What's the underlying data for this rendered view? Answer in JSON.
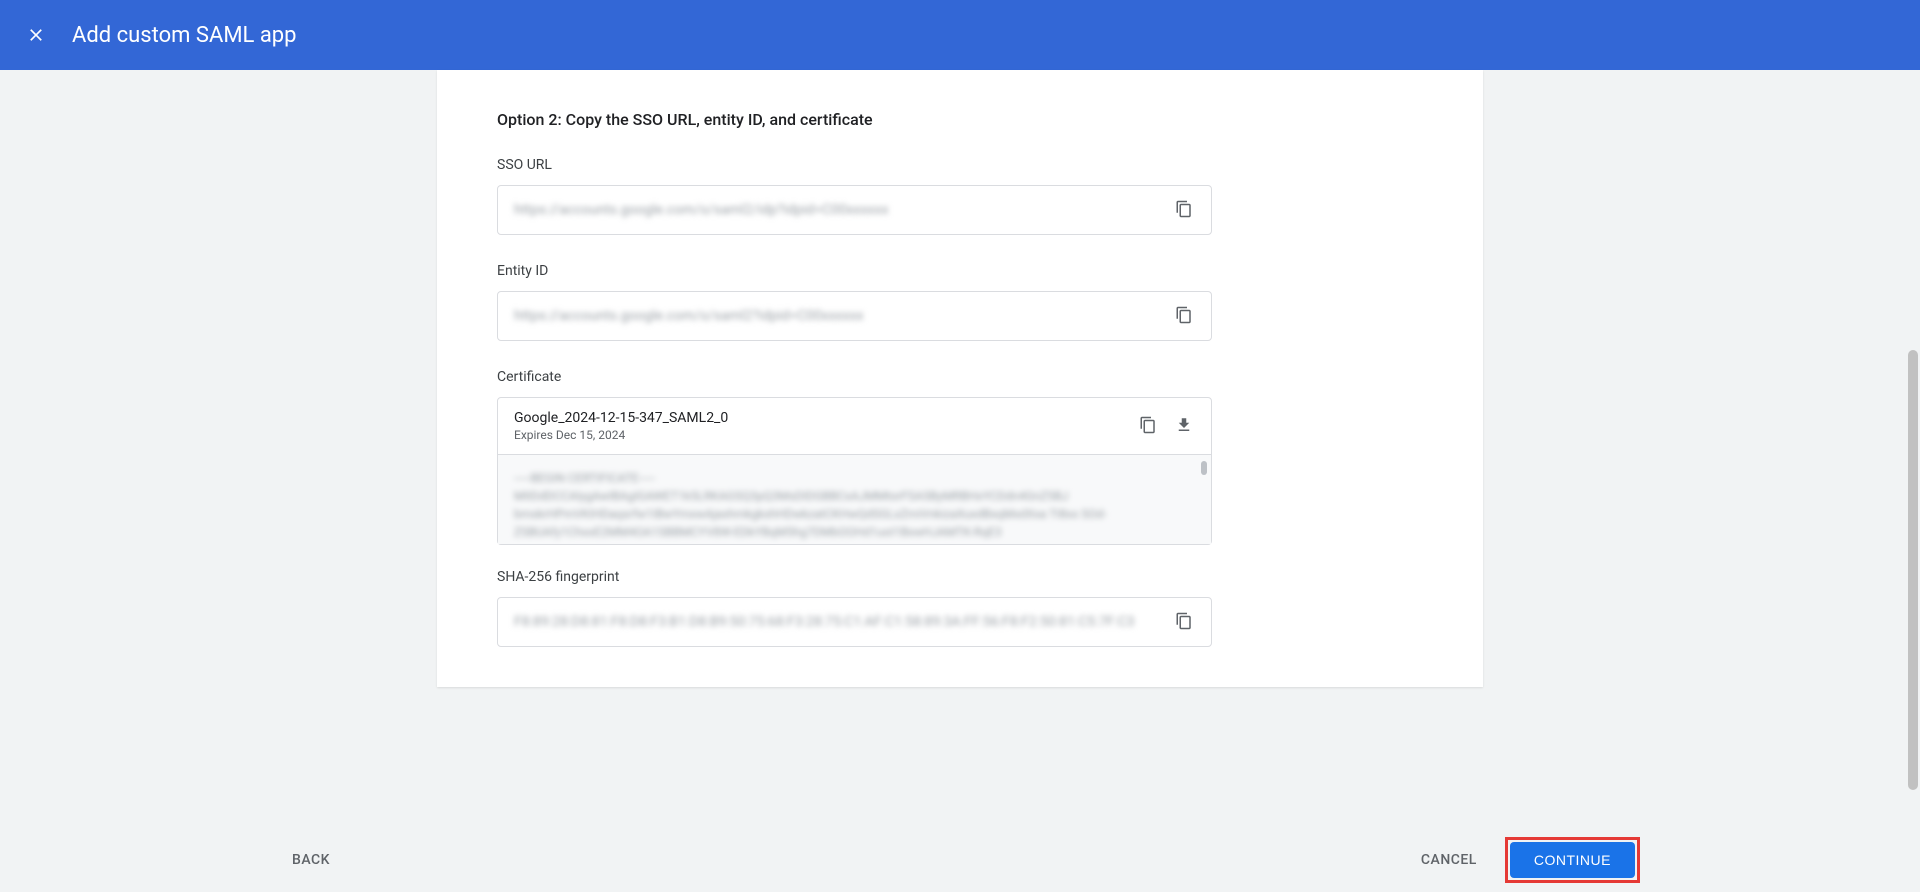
{
  "header": {
    "title": "Add custom SAML app"
  },
  "content": {
    "optionTitle": "Option 2: Copy the SSO URL, entity ID, and certificate",
    "fields": {
      "ssoUrl": {
        "label": "SSO URL",
        "value": "https://accounts.google.com/o/saml2/idp?idpid=C00xxxxxx"
      },
      "entityId": {
        "label": "Entity ID",
        "value": "https://accounts.google.com/o/saml2?idpid=C00xxxxxx"
      },
      "certificate": {
        "label": "Certificate",
        "name": "Google_2024-12-15-347_SAML2_0",
        "expires": "Expires Dec 15, 2024",
        "content": "-----BEGIN CERTIFICATE-----\nMIIDdDCCAlygAwIBAgIGAWET1k5LRKAGSQ3pQ3MsDIDGBBCxAJMMtorFSA5ByMRBHxYCDdn4GnZ5BJ\nbmskrHPmVKIHDaqsrfw1IBwYmxwAjaxhmkgkxhHDwkzatCKHwQdSGLxZmiVnkizaXuxdBxqMxdXxa TI8xx\nSOd-ZSBUAfy1ChxxE2MM4OA1SBBMCYV8W-EDkYBqM5hg7DMbOOHd1uoI1BxwHJAMTK-RqE3\n"
      },
      "fingerprint": {
        "label": "SHA-256 fingerprint",
        "value": "F8:89:28:D8:81:F8:D8:F3:B1:D8:B9:50:75:68:F3:28:75:C1:AF:C1:58:89:3A:FF:56:F8:F2:50:81:C5:7F:C3"
      }
    }
  },
  "footer": {
    "back": "BACK",
    "cancel": "CANCEL",
    "continue": "CONTINUE"
  }
}
